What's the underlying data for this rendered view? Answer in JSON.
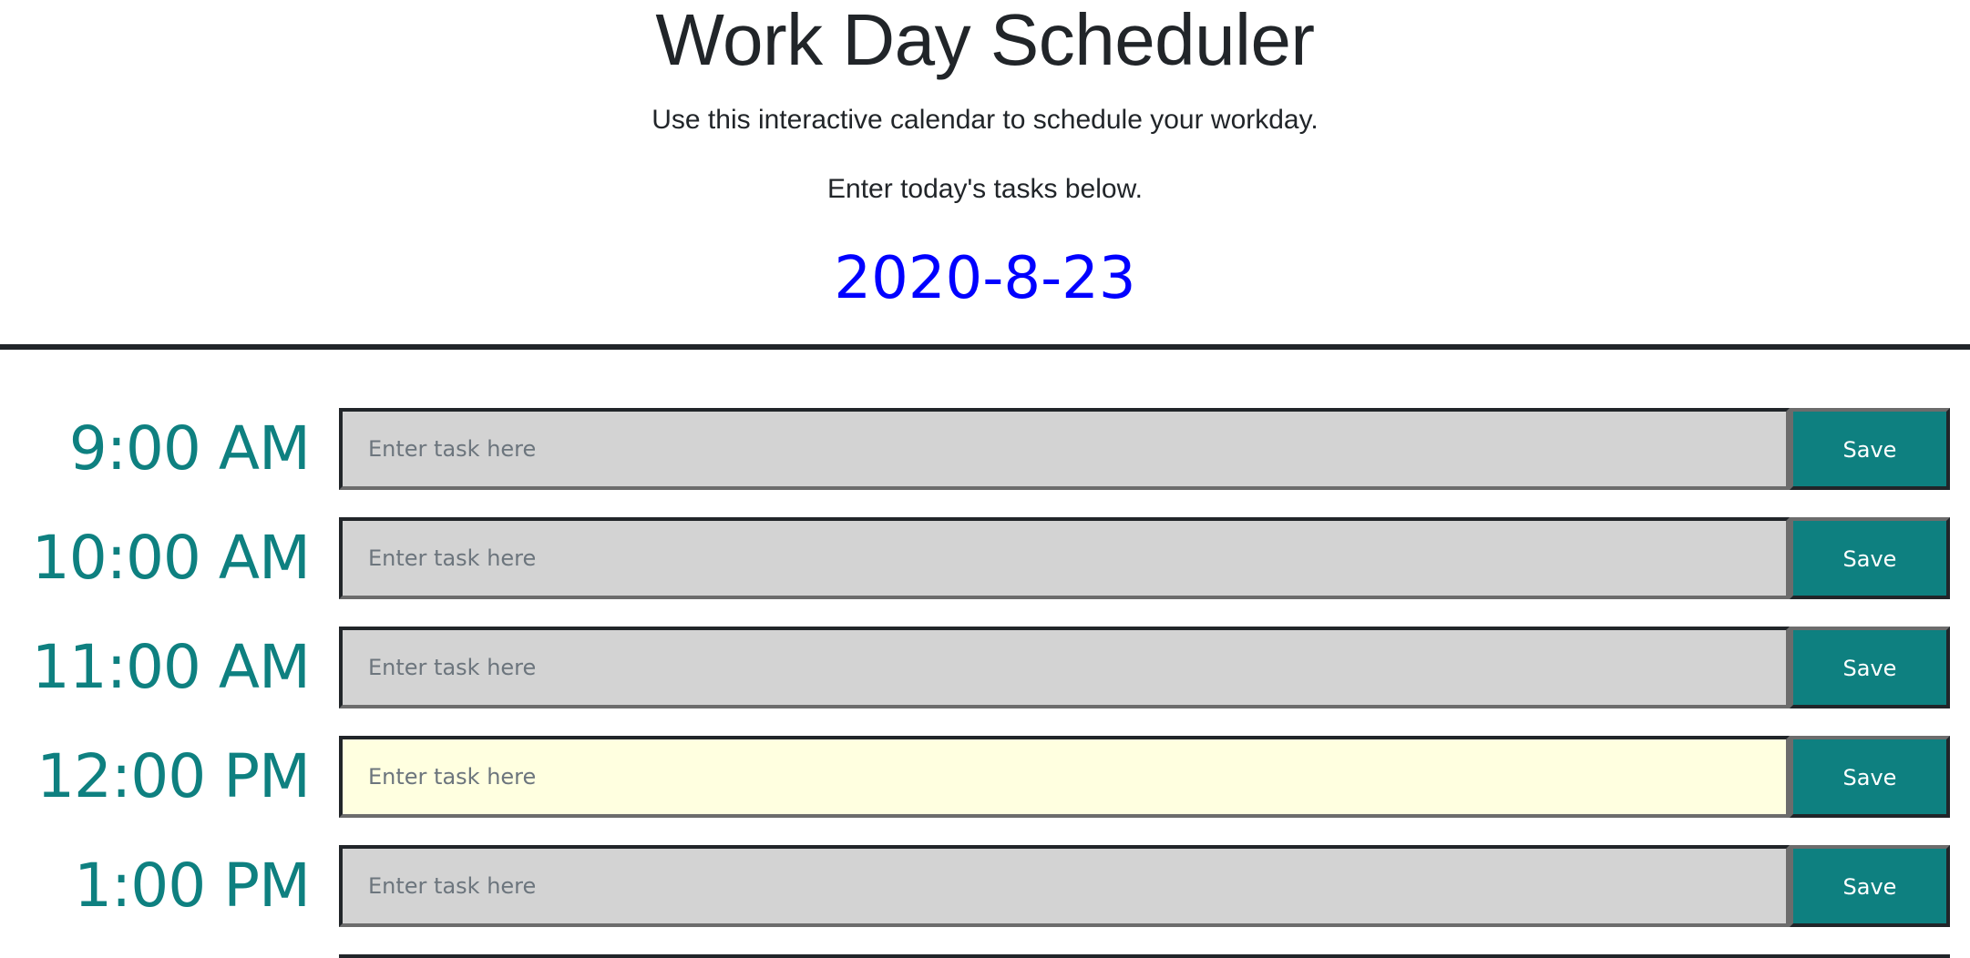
{
  "header": {
    "title": "Work Day Scheduler",
    "lead_line_1": "Use this interactive calendar to schedule your workday.",
    "lead_line_2": "Enter today's tasks below.",
    "current_date": "2020-8-23"
  },
  "task_placeholder": "Enter task here",
  "save_label": "Save",
  "colors": {
    "teal": "#0e8080",
    "past": "#d3d3d3",
    "present": "#ffffe0",
    "date": "#0000ff"
  },
  "rows": [
    {
      "hour": "9:00 AM",
      "state": "past",
      "value": ""
    },
    {
      "hour": "10:00 AM",
      "state": "past",
      "value": ""
    },
    {
      "hour": "11:00 AM",
      "state": "past",
      "value": ""
    },
    {
      "hour": "12:00 PM",
      "state": "present",
      "value": ""
    },
    {
      "hour": "1:00 PM",
      "state": "past",
      "value": ""
    }
  ]
}
